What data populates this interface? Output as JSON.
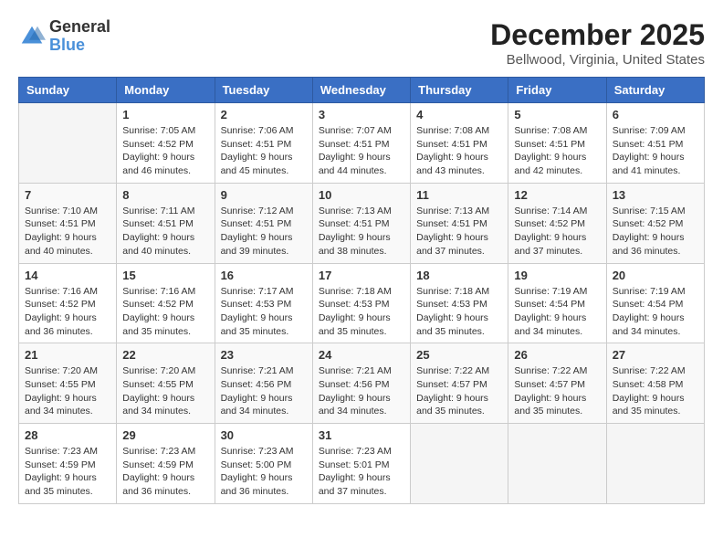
{
  "logo": {
    "line1": "General",
    "line2": "Blue"
  },
  "title": "December 2025",
  "subtitle": "Bellwood, Virginia, United States",
  "headers": [
    "Sunday",
    "Monday",
    "Tuesday",
    "Wednesday",
    "Thursday",
    "Friday",
    "Saturday"
  ],
  "weeks": [
    [
      {
        "day": "",
        "info": ""
      },
      {
        "day": "1",
        "info": "Sunrise: 7:05 AM\nSunset: 4:52 PM\nDaylight: 9 hours\nand 46 minutes."
      },
      {
        "day": "2",
        "info": "Sunrise: 7:06 AM\nSunset: 4:51 PM\nDaylight: 9 hours\nand 45 minutes."
      },
      {
        "day": "3",
        "info": "Sunrise: 7:07 AM\nSunset: 4:51 PM\nDaylight: 9 hours\nand 44 minutes."
      },
      {
        "day": "4",
        "info": "Sunrise: 7:08 AM\nSunset: 4:51 PM\nDaylight: 9 hours\nand 43 minutes."
      },
      {
        "day": "5",
        "info": "Sunrise: 7:08 AM\nSunset: 4:51 PM\nDaylight: 9 hours\nand 42 minutes."
      },
      {
        "day": "6",
        "info": "Sunrise: 7:09 AM\nSunset: 4:51 PM\nDaylight: 9 hours\nand 41 minutes."
      }
    ],
    [
      {
        "day": "7",
        "info": "Sunrise: 7:10 AM\nSunset: 4:51 PM\nDaylight: 9 hours\nand 40 minutes."
      },
      {
        "day": "8",
        "info": "Sunrise: 7:11 AM\nSunset: 4:51 PM\nDaylight: 9 hours\nand 40 minutes."
      },
      {
        "day": "9",
        "info": "Sunrise: 7:12 AM\nSunset: 4:51 PM\nDaylight: 9 hours\nand 39 minutes."
      },
      {
        "day": "10",
        "info": "Sunrise: 7:13 AM\nSunset: 4:51 PM\nDaylight: 9 hours\nand 38 minutes."
      },
      {
        "day": "11",
        "info": "Sunrise: 7:13 AM\nSunset: 4:51 PM\nDaylight: 9 hours\nand 37 minutes."
      },
      {
        "day": "12",
        "info": "Sunrise: 7:14 AM\nSunset: 4:52 PM\nDaylight: 9 hours\nand 37 minutes."
      },
      {
        "day": "13",
        "info": "Sunrise: 7:15 AM\nSunset: 4:52 PM\nDaylight: 9 hours\nand 36 minutes."
      }
    ],
    [
      {
        "day": "14",
        "info": "Sunrise: 7:16 AM\nSunset: 4:52 PM\nDaylight: 9 hours\nand 36 minutes."
      },
      {
        "day": "15",
        "info": "Sunrise: 7:16 AM\nSunset: 4:52 PM\nDaylight: 9 hours\nand 35 minutes."
      },
      {
        "day": "16",
        "info": "Sunrise: 7:17 AM\nSunset: 4:53 PM\nDaylight: 9 hours\nand 35 minutes."
      },
      {
        "day": "17",
        "info": "Sunrise: 7:18 AM\nSunset: 4:53 PM\nDaylight: 9 hours\nand 35 minutes."
      },
      {
        "day": "18",
        "info": "Sunrise: 7:18 AM\nSunset: 4:53 PM\nDaylight: 9 hours\nand 35 minutes."
      },
      {
        "day": "19",
        "info": "Sunrise: 7:19 AM\nSunset: 4:54 PM\nDaylight: 9 hours\nand 34 minutes."
      },
      {
        "day": "20",
        "info": "Sunrise: 7:19 AM\nSunset: 4:54 PM\nDaylight: 9 hours\nand 34 minutes."
      }
    ],
    [
      {
        "day": "21",
        "info": "Sunrise: 7:20 AM\nSunset: 4:55 PM\nDaylight: 9 hours\nand 34 minutes."
      },
      {
        "day": "22",
        "info": "Sunrise: 7:20 AM\nSunset: 4:55 PM\nDaylight: 9 hours\nand 34 minutes."
      },
      {
        "day": "23",
        "info": "Sunrise: 7:21 AM\nSunset: 4:56 PM\nDaylight: 9 hours\nand 34 minutes."
      },
      {
        "day": "24",
        "info": "Sunrise: 7:21 AM\nSunset: 4:56 PM\nDaylight: 9 hours\nand 34 minutes."
      },
      {
        "day": "25",
        "info": "Sunrise: 7:22 AM\nSunset: 4:57 PM\nDaylight: 9 hours\nand 35 minutes."
      },
      {
        "day": "26",
        "info": "Sunrise: 7:22 AM\nSunset: 4:57 PM\nDaylight: 9 hours\nand 35 minutes."
      },
      {
        "day": "27",
        "info": "Sunrise: 7:22 AM\nSunset: 4:58 PM\nDaylight: 9 hours\nand 35 minutes."
      }
    ],
    [
      {
        "day": "28",
        "info": "Sunrise: 7:23 AM\nSunset: 4:59 PM\nDaylight: 9 hours\nand 35 minutes."
      },
      {
        "day": "29",
        "info": "Sunrise: 7:23 AM\nSunset: 4:59 PM\nDaylight: 9 hours\nand 36 minutes."
      },
      {
        "day": "30",
        "info": "Sunrise: 7:23 AM\nSunset: 5:00 PM\nDaylight: 9 hours\nand 36 minutes."
      },
      {
        "day": "31",
        "info": "Sunrise: 7:23 AM\nSunset: 5:01 PM\nDaylight: 9 hours\nand 37 minutes."
      },
      {
        "day": "",
        "info": ""
      },
      {
        "day": "",
        "info": ""
      },
      {
        "day": "",
        "info": ""
      }
    ]
  ]
}
